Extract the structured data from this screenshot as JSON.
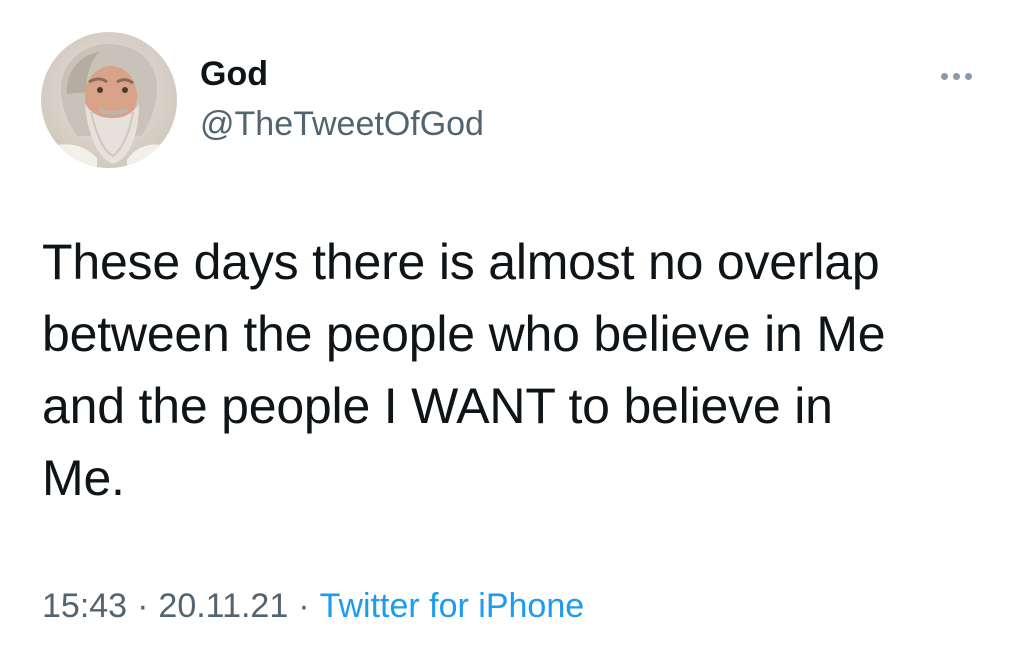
{
  "tweet": {
    "author": {
      "display_name": "God",
      "handle": "@TheTweetOfGod",
      "avatar_icon": "profile-photo"
    },
    "more_icon": "more-horizontal-icon",
    "text_lines": [
      "These days there is almost no overlap",
      "between the people who believe in Me",
      "and the people I WANT to believe in",
      "Me."
    ],
    "time": "15:43",
    "separator": "·",
    "date": "20.11.21",
    "source": "Twitter for iPhone"
  },
  "colors": {
    "text_primary": "#0f1419",
    "text_secondary": "#536471",
    "link": "#1d9bf0",
    "background": "#ffffff"
  }
}
